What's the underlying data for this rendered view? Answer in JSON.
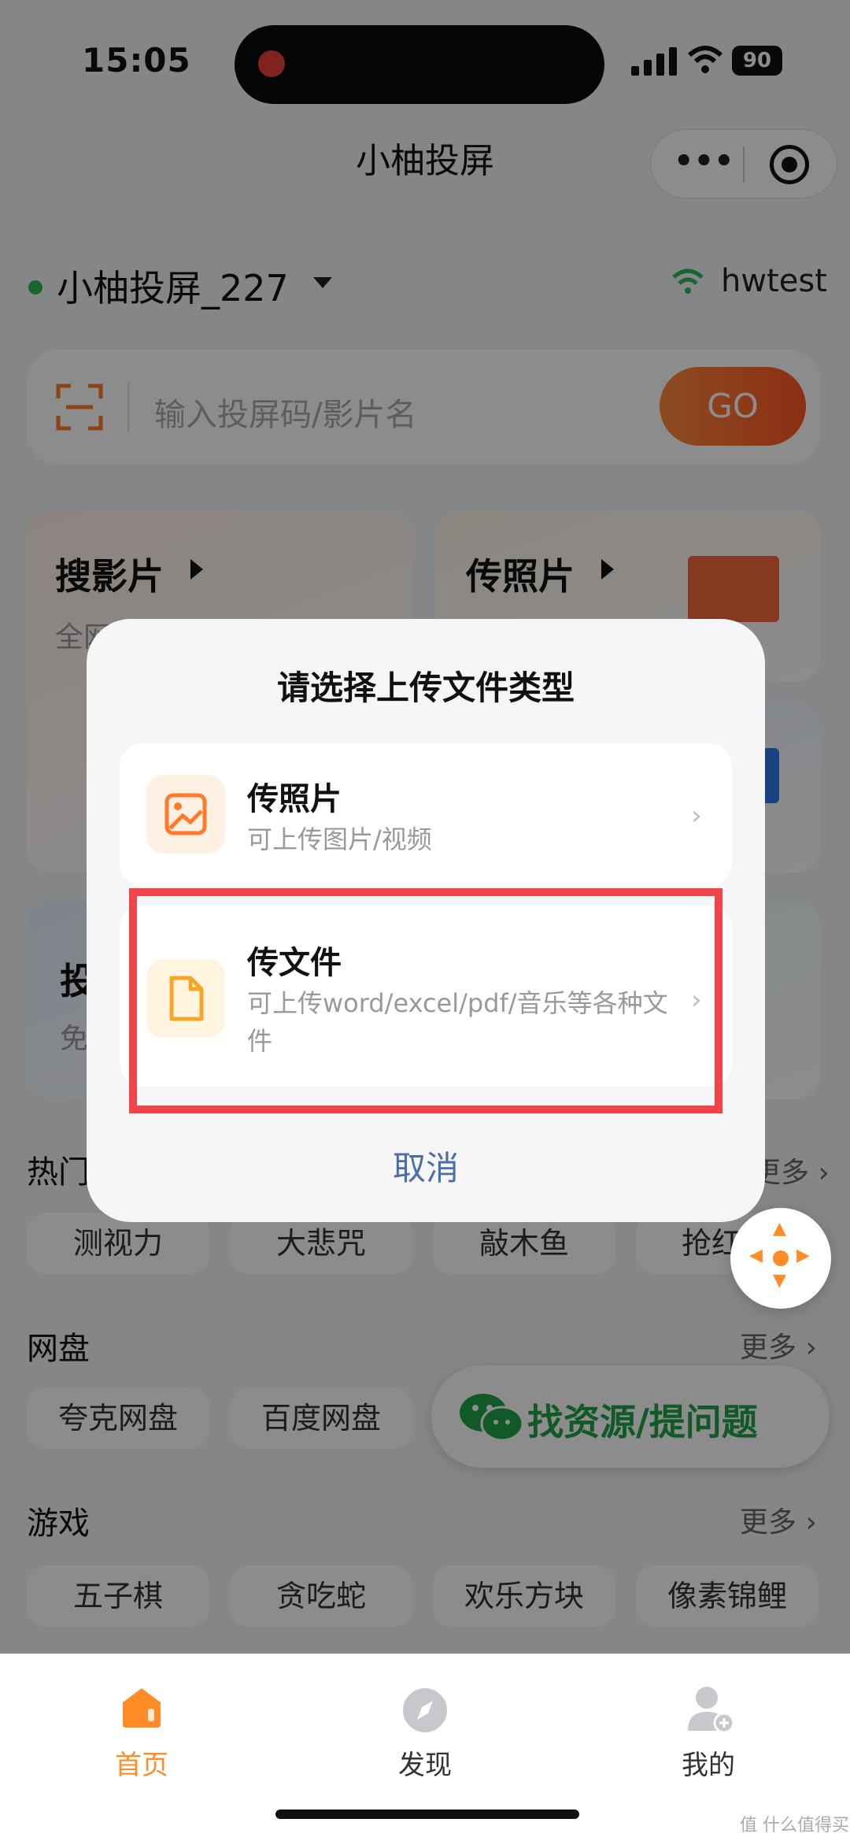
{
  "status_bar": {
    "time": "15:05",
    "battery": "90"
  },
  "nav": {
    "title": "小柚投屏"
  },
  "device": {
    "name": "小柚投屏_227",
    "network": "hwtest"
  },
  "search": {
    "placeholder": "输入投屏码/影片名",
    "go_label": "GO"
  },
  "cards": [
    {
      "title": "搜影片",
      "subtitle": "全网"
    },
    {
      "title": "传照片",
      "subtitle": ""
    },
    {
      "title": "投",
      "subtitle": "免"
    }
  ],
  "sections": {
    "hot": {
      "title": "热门",
      "more": "更多",
      "chips": [
        "测视力",
        "大悲咒",
        "敲木鱼",
        "抢红"
      ]
    },
    "netdisk": {
      "title": "网盘",
      "more": "更多",
      "chips": [
        "夸克网盘",
        "百度网盘"
      ]
    },
    "games": {
      "title": "游戏",
      "more": "更多",
      "chips": [
        "五子棋",
        "贪吃蛇",
        "欢乐方块",
        "像素锦鲤"
      ]
    }
  },
  "wechat_pill": {
    "label": "找资源/提问题"
  },
  "tabbar": {
    "items": [
      {
        "label": "首页",
        "active": true
      },
      {
        "label": "发现",
        "active": false
      },
      {
        "label": "我的",
        "active": false
      }
    ]
  },
  "dialog": {
    "title": "请选择上传文件类型",
    "options": [
      {
        "title": "传照片",
        "subtitle": "可上传图片/视频",
        "icon": "image-icon"
      },
      {
        "title": "传文件",
        "subtitle": "可上传word/excel/pdf/音乐等各种文件",
        "icon": "document-icon"
      }
    ],
    "cancel_label": "取消"
  },
  "watermark": "值 什么值得买",
  "colors": {
    "accent": "#ff8c26",
    "highlight": "#f0464b",
    "cancel": "#4a6fa5",
    "wechat": "#1fa54a"
  }
}
